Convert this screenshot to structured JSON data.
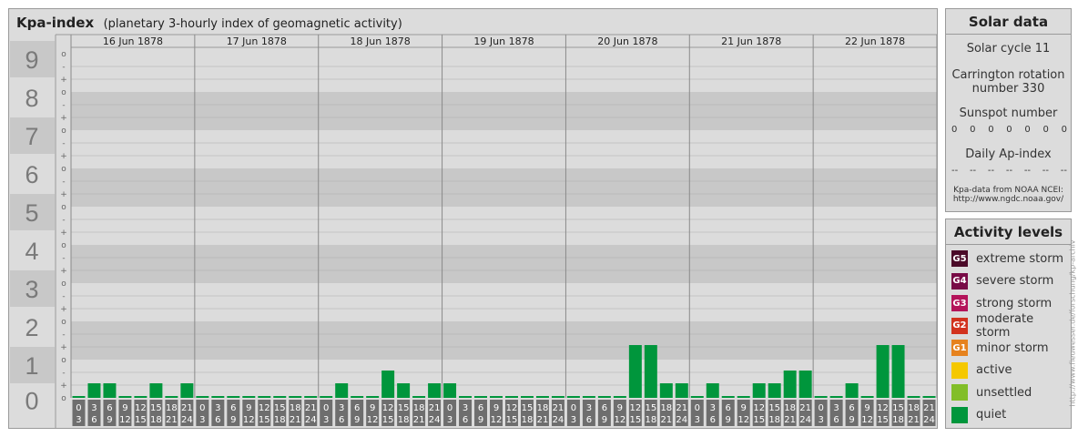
{
  "header": {
    "title": "Kpa-index",
    "subtitle": "(planetary 3-hourly index of geomagnetic activity)"
  },
  "chart_data": {
    "type": "bar",
    "title": "Kpa-index",
    "subtitle": "(planetary 3-hourly index of geomagnetic activity)",
    "ylim": [
      0,
      9
    ],
    "y_ticks": [
      "0",
      "1",
      "2",
      "3",
      "4",
      "5",
      "6",
      "7",
      "8",
      "9"
    ],
    "y_minor_ticks": [
      "-",
      "o",
      "+"
    ],
    "days": [
      "16 Jun 1878",
      "17 Jun 1878",
      "18 Jun 1878",
      "19 Jun 1878",
      "20 Jun 1878",
      "21 Jun 1878",
      "22 Jun 1878"
    ],
    "interval_labels": [
      [
        "0",
        "3"
      ],
      [
        "3",
        "6"
      ],
      [
        "6",
        "9"
      ],
      [
        "9",
        "12"
      ],
      [
        "12",
        "15"
      ],
      [
        "15",
        "18"
      ],
      [
        "18",
        "21"
      ],
      [
        "21",
        "24"
      ]
    ],
    "grid": true,
    "series": [
      {
        "color": "#00963c",
        "values": [
          [
            0,
            0.333,
            0.333,
            0,
            0,
            0.333,
            0,
            0.333
          ],
          [
            0,
            0,
            0,
            0,
            0,
            0,
            0,
            0
          ],
          [
            0,
            0.333,
            0,
            0,
            0.667,
            0.333,
            0,
            0.333
          ],
          [
            0.333,
            0,
            0,
            0,
            0,
            0,
            0,
            0
          ],
          [
            0,
            0,
            0,
            0,
            1.333,
            1.333,
            0.333,
            0.333
          ],
          [
            0,
            0.333,
            0,
            0,
            0.333,
            0.333,
            0.667,
            0.667
          ],
          [
            0,
            0,
            0.333,
            0,
            1.333,
            1.333,
            0,
            0
          ]
        ]
      }
    ]
  },
  "solar": {
    "heading": "Solar data",
    "cycle": "Solar cycle 11",
    "carrington_line1": "Carrington rotation",
    "carrington_line2": "number 330",
    "sunspot_label": "Sunspot number",
    "sunspot_values": [
      "0",
      "0",
      "0",
      "0",
      "0",
      "0",
      "0"
    ],
    "ap_label": "Daily Ap-index",
    "ap_values": [
      "--",
      "--",
      "--",
      "--",
      "--",
      "--",
      "--"
    ],
    "source_line1": "Kpa-data from NOAA NCEI:",
    "source_line2": "http://www.ngdc.noaa.gov/"
  },
  "levels": {
    "heading": "Activity levels",
    "items": [
      {
        "badge": "G5",
        "label": "extreme storm",
        "color": "#4b0a28"
      },
      {
        "badge": "G4",
        "label": "severe storm",
        "color": "#780a46"
      },
      {
        "badge": "G3",
        "label": "strong storm",
        "color": "#b4145a"
      },
      {
        "badge": "G2",
        "label": "moderate storm",
        "color": "#d2321e"
      },
      {
        "badge": "G1",
        "label": "minor storm",
        "color": "#e6821e"
      },
      {
        "badge": "",
        "label": "active",
        "color": "#f5c800"
      },
      {
        "badge": "",
        "label": "unsettled",
        "color": "#82be28"
      },
      {
        "badge": "",
        "label": "quiet",
        "color": "#00963c"
      }
    ]
  },
  "credit": "http://www.fieuwesser.de/forschung/kp-archiv"
}
